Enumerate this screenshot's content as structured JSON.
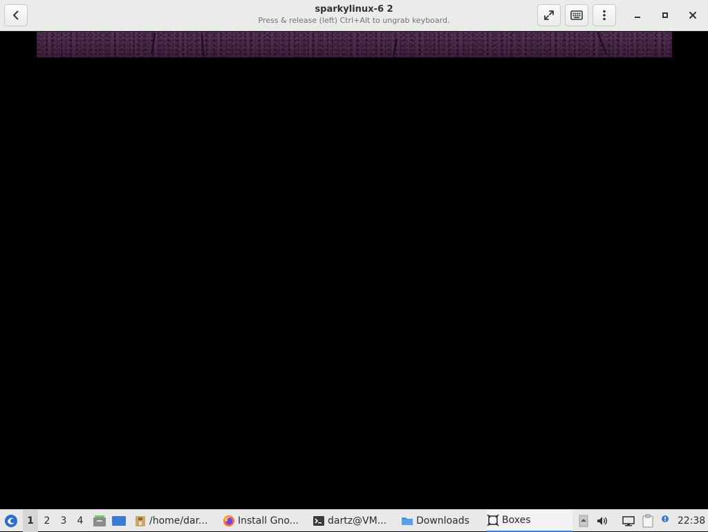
{
  "window": {
    "title": "sparkylinux-6 2",
    "subtitle": "Press & release (left) Ctrl+Alt to ungrab keyboard."
  },
  "header_buttons": {
    "back": "back-arrow-icon",
    "fullscreen": "fullscreen-icon",
    "keyboard": "keyboard-icon",
    "menu": "vertical-dots-icon",
    "minimize": "minimize-icon",
    "maximize": "maximize-icon",
    "close": "close-icon"
  },
  "taskbar": {
    "workspaces": [
      "1",
      "2",
      "3",
      "4"
    ],
    "active_workspace": "1",
    "tasks": [
      {
        "label": "/home/dar...",
        "icon": "archive-folder-icon"
      },
      {
        "label": "Install Gno...",
        "icon": "firefox-icon"
      },
      {
        "label": "dartz@VM...",
        "icon": "terminal-icon"
      },
      {
        "label": "Downloads",
        "icon": "folder-icon"
      },
      {
        "label": "Boxes",
        "icon": "boxes-icon"
      }
    ],
    "active_task": "Boxes",
    "clock": "22:38"
  },
  "colors": {
    "header_bg": "#ebebeb",
    "vm_banner": "#4c2b4c",
    "accent": "#3584e4"
  }
}
